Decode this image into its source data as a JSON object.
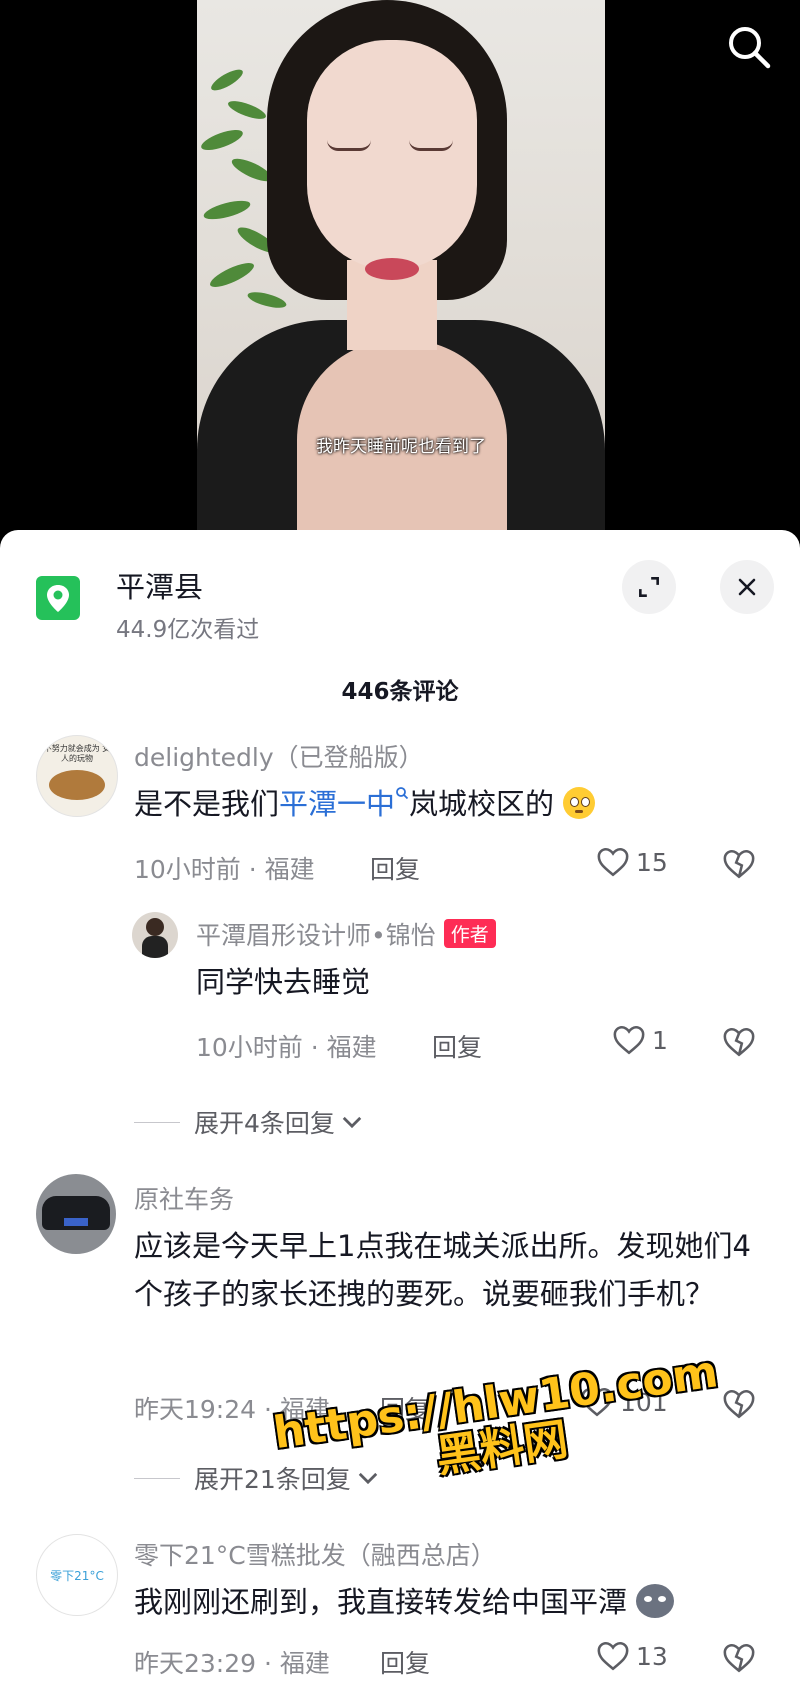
{
  "video": {
    "subtitle": "我昨天睡前呢也看到了"
  },
  "location": {
    "title": "平潭县",
    "views": "44.9亿次看过"
  },
  "comments_header": "446条评论",
  "comments": [
    {
      "username": "delightedly（已登船版）",
      "text_before": "是不是我们",
      "link": "平潭一中",
      "text_after": "岚城校区的",
      "meta": "10小时前 · 福建",
      "reply": "回复",
      "likes": "15",
      "avatar_text": "不努力就会成为 女人的玩物"
    },
    {
      "username": "平潭眉形设计师•锦怡",
      "badge": "作者",
      "text": "同学快去睡觉",
      "meta": "10小时前 · 福建",
      "reply": "回复",
      "likes": "1"
    },
    {
      "expand": "展开4条回复"
    },
    {
      "username": "原社车务",
      "text": "应该是今天早上1点我在城关派出所。发现她们4个孩子的家长还拽的要死。说要砸我们手机？",
      "meta": "昨天19:24 · 福建",
      "reply": "回复",
      "likes": "101"
    },
    {
      "expand": "展开21条回复"
    },
    {
      "username": "零下21°C雪糕批发（融西总店）",
      "text": "我刚刚还刷到，我直接转发给中国平潭",
      "meta": "昨天23:29 · 福建",
      "reply": "回复",
      "likes": "13",
      "avatar_text": "零下21°C"
    }
  ],
  "watermark": {
    "line1": "https://hlw10.com",
    "line2": "黑料网"
  },
  "colors": {
    "accent": "#fe2c55",
    "location_green": "#25c15a",
    "link_blue": "#2b6fd6",
    "watermark": "#ffc21a"
  }
}
